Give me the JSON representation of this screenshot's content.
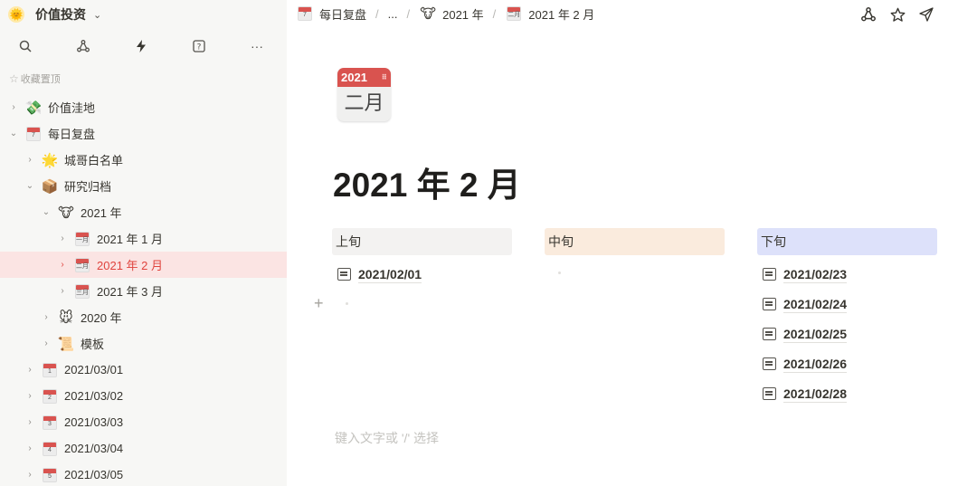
{
  "workspace": {
    "icon": "sun-face",
    "name": "价值投资"
  },
  "sidebar_tools": [
    "search-icon",
    "graph-icon",
    "lightning-icon",
    "help-icon",
    "more-icon"
  ],
  "favorites_label": "收藏置顶",
  "tree": [
    {
      "label": "价值洼地",
      "icon": "money-wings",
      "glyph": "💸",
      "expanded": false
    },
    {
      "label": "每日复盘",
      "icon": "calendar",
      "cal": "7",
      "expanded": true
    },
    {
      "label": "城哥白名单",
      "icon": "glowing-star",
      "glyph": "🌟",
      "expanded": false
    },
    {
      "label": "研究归档",
      "icon": "package",
      "glyph": "📦",
      "expanded": true
    },
    {
      "label": "2021 年",
      "icon": "cow-face",
      "glyph": "🐮",
      "expanded": true
    },
    {
      "label": "2021 年 1 月",
      "icon": "calendar",
      "cal": "一月",
      "expanded": false
    },
    {
      "label": "2021 年 2 月",
      "icon": "calendar",
      "cal": "二月",
      "expanded": false,
      "active": true
    },
    {
      "label": "2021 年 3 月",
      "icon": "calendar",
      "cal": "三月",
      "expanded": false
    },
    {
      "label": "2020 年",
      "icon": "mouse-face",
      "glyph": "🐭",
      "expanded": false
    },
    {
      "label": "模板",
      "icon": "scroll",
      "glyph": "📜",
      "expanded": false
    },
    {
      "label": "2021/03/01",
      "icon": "calendar",
      "cal": "1",
      "expanded": false
    },
    {
      "label": "2021/03/02",
      "icon": "calendar",
      "cal": "2",
      "expanded": false
    },
    {
      "label": "2021/03/03",
      "icon": "calendar",
      "cal": "3",
      "expanded": false
    },
    {
      "label": "2021/03/04",
      "icon": "calendar",
      "cal": "4",
      "expanded": false
    },
    {
      "label": "2021/03/05",
      "icon": "calendar",
      "cal": "5",
      "expanded": false
    }
  ],
  "breadcrumb": [
    {
      "label": "每日复盘",
      "cal": "7"
    },
    {
      "label": "..."
    },
    {
      "label": "2021 年",
      "glyph": "🐮"
    },
    {
      "label": "2021 年 2 月",
      "cal": "二月"
    }
  ],
  "topbar_actions": [
    "graph-icon",
    "star-icon",
    "share-icon"
  ],
  "page": {
    "icon_year": "2021",
    "icon_month": "二月",
    "title": "2021 年 2 月",
    "placeholder": "键入文字或 '/' 选择"
  },
  "columns": [
    {
      "name": "上旬",
      "color": "#f3f2f1",
      "cards": [
        "2021/02/01"
      ]
    },
    {
      "name": "中旬",
      "color": "#faebdd",
      "cards": []
    },
    {
      "name": "下旬",
      "color": "#dde1fa",
      "cards": [
        "2021/02/23",
        "2021/02/24",
        "2021/02/25",
        "2021/02/26",
        "2021/02/28"
      ]
    }
  ]
}
